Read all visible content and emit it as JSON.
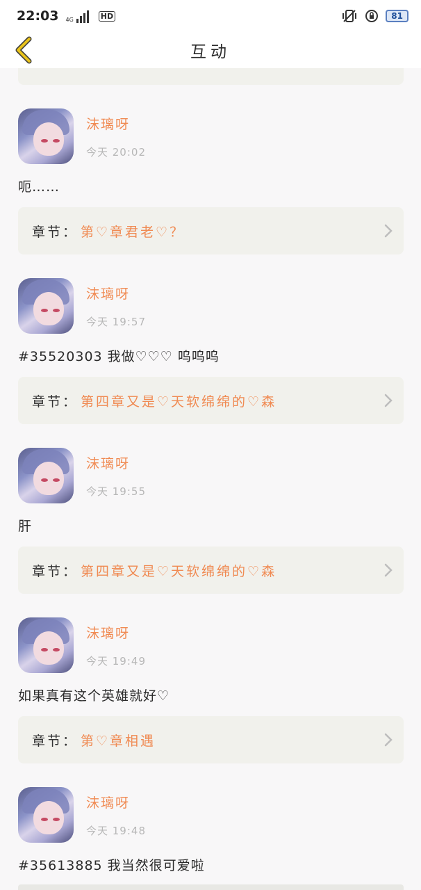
{
  "status_bar": {
    "time": "22:03",
    "network_small": "4G",
    "hd": "HD",
    "battery": "81",
    "icons": [
      "signal-icon",
      "vibrate-icon",
      "alarm-icon",
      "battery-icon"
    ]
  },
  "header": {
    "title": "互动",
    "back_icon": "chevron-left-icon"
  },
  "chapter_label": "章节：",
  "comments": [
    {
      "username": "沫璃呀",
      "time": "今天 20:02",
      "content": "呃……",
      "chapter_title": "第♡章君老♡？"
    },
    {
      "username": "沫璃呀",
      "time": "今天 19:57",
      "content": "#35520303 我做♡♡♡ 呜呜呜",
      "chapter_title": "第四章又是♡天软绵绵的♡森"
    },
    {
      "username": "沫璃呀",
      "time": "今天 19:55",
      "content": "肝",
      "chapter_title": "第四章又是♡天软绵绵的♡森"
    },
    {
      "username": "沫璃呀",
      "time": "今天 19:49",
      "content": "如果真有这个英雄就好♡",
      "chapter_title": "第♡章相遇"
    },
    {
      "username": "沫璃呀",
      "time": "今天 19:48",
      "content": "#35613885 我当然很可爱啦",
      "chapter_title": ""
    }
  ],
  "colors": {
    "accent": "#f08a52",
    "card_bg": "#f1f1ec",
    "page_bg": "#f8f7f8",
    "back_icon": "#e8c21c"
  }
}
